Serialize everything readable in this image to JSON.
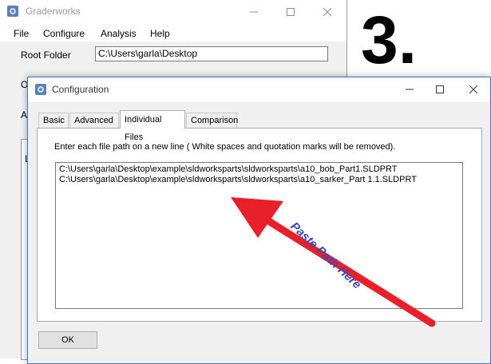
{
  "main_window": {
    "title": "Graderworks",
    "menu": [
      "File",
      "Configure",
      "Analysis",
      "Help"
    ],
    "root_folder_label": "Root Folder",
    "root_folder_value": "C:\\Users\\garla\\Desktop",
    "obscured_labels": [
      "O",
      "A",
      "L"
    ]
  },
  "overlay": {
    "step_number": "3.",
    "annotation": "Paste Path Here",
    "arrow_color": "#e8202a",
    "annotation_color": "#3b48b8"
  },
  "config_dialog": {
    "title": "Configuration",
    "tabs": [
      "Basic",
      "Advanced",
      "Individual Files",
      "Comparison"
    ],
    "active_tab": "Individual Files",
    "instructions": "Enter each file path on a new line ( White spaces and quotation marks will be removed).",
    "paths": [
      "C:\\Users\\garla\\Desktop\\example\\sldworksparts\\sldworksparts\\a10_bob_Part1.SLDPRT",
      "C:\\Users\\garla\\Desktop\\example\\sldworksparts\\sldworksparts\\a10_sarker_Part 1.1.SLDPRT"
    ],
    "ok_label": "OK"
  }
}
